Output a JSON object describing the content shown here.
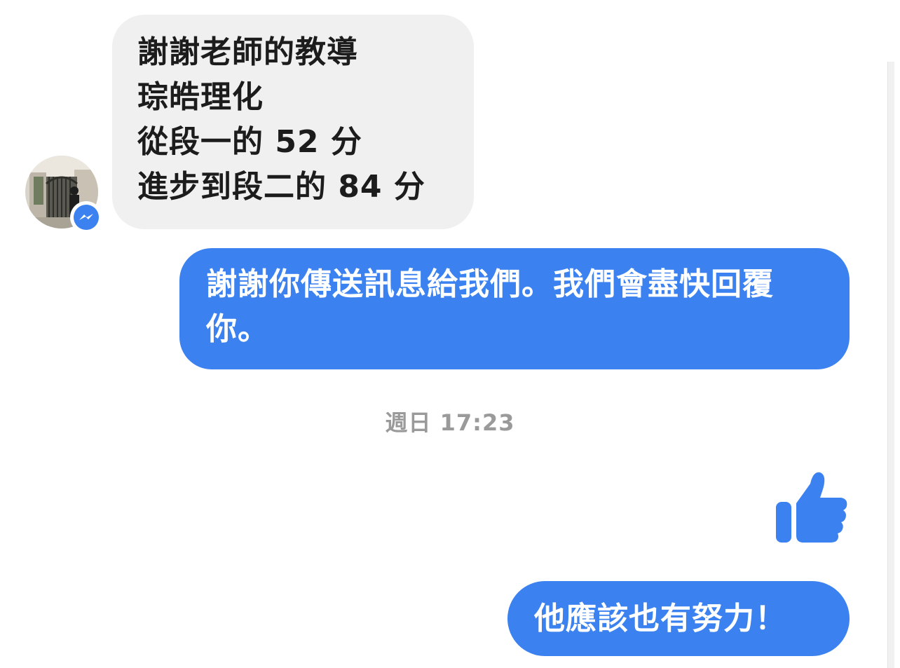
{
  "incoming_message": {
    "lines": [
      "謝謝老師的教導",
      "琮皓理化",
      "從段一的 52 分",
      "進步到段二的 84 分"
    ]
  },
  "outgoing_messages": [
    {
      "text": "謝謝你傳送訊息給我們。我們會盡快回覆你。"
    },
    {
      "text": "他應該也有努力！"
    }
  ],
  "timestamp": "週日 17:23",
  "icons": {
    "avatar": "avatar-photo",
    "badge": "messenger-icon",
    "like": "thumbs-up-icon"
  },
  "colors": {
    "outgoing_bubble": "#3b82f0",
    "incoming_bubble": "#f0f0f0",
    "timestamp": "#9a9a9a"
  }
}
